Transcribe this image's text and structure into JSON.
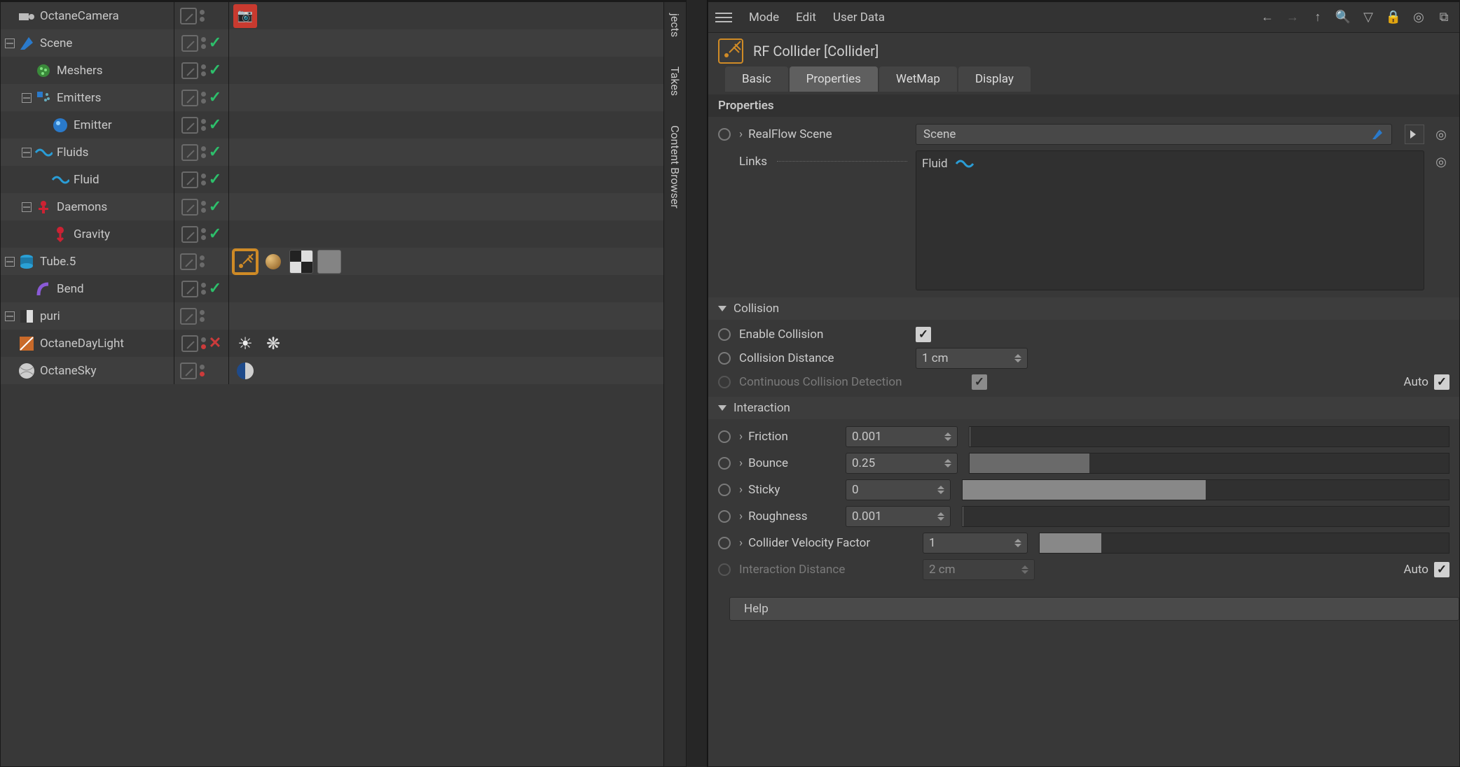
{
  "objects": {
    "items": [
      {
        "name": "OctaneCamera",
        "indent": 0,
        "expander": "none",
        "status": "none",
        "tags": [
          "camera-rec"
        ]
      },
      {
        "name": "Scene",
        "indent": 0,
        "expander": "minus",
        "status": "check",
        "tags": []
      },
      {
        "name": "Meshers",
        "indent": 1,
        "expander": "none",
        "status": "check",
        "tags": []
      },
      {
        "name": "Emitters",
        "indent": 1,
        "expander": "minus",
        "status": "check",
        "tags": []
      },
      {
        "name": "Emitter",
        "indent": 2,
        "expander": "none",
        "status": "check",
        "tags": []
      },
      {
        "name": "Fluids",
        "indent": 1,
        "expander": "minus",
        "status": "check",
        "tags": []
      },
      {
        "name": "Fluid",
        "indent": 2,
        "expander": "none",
        "status": "check",
        "tags": []
      },
      {
        "name": "Daemons",
        "indent": 1,
        "expander": "minus",
        "status": "check",
        "tags": []
      },
      {
        "name": "Gravity",
        "indent": 2,
        "expander": "none",
        "status": "check",
        "tags": []
      },
      {
        "name": "Tube.5",
        "indent": 0,
        "expander": "minus",
        "status": "none",
        "tags": [
          "collider",
          "ball",
          "checker",
          "noise"
        ],
        "selected_tag": 0
      },
      {
        "name": "Bend",
        "indent": 1,
        "expander": "none",
        "status": "check",
        "tags": []
      },
      {
        "name": "puri",
        "indent": 0,
        "expander": "plus",
        "status": "none",
        "tags": []
      },
      {
        "name": "OctaneDayLight",
        "indent": 0,
        "expander": "none",
        "status": "x",
        "dots": "red",
        "tags": [
          "sun",
          "gear"
        ]
      },
      {
        "name": "OctaneSky",
        "indent": 0,
        "expander": "none",
        "status": "none",
        "dots": "red",
        "tags": [
          "halfsphere"
        ]
      }
    ]
  },
  "side_tabs": {
    "objects_trunc": "jects",
    "takes": "Takes",
    "content_browser": "Content Browser"
  },
  "menu": {
    "mode": "Mode",
    "edit": "Edit",
    "user_data": "User Data"
  },
  "attr": {
    "title": "RF Collider [Collider]",
    "tabs": {
      "basic": "Basic",
      "properties": "Properties",
      "wetmap": "WetMap",
      "display": "Display"
    },
    "section": "Properties",
    "realflow_scene_label": "RealFlow Scene",
    "realflow_scene_value": "Scene",
    "links_label": "Links",
    "links_item": "Fluid",
    "groups": {
      "collision": "Collision",
      "interaction": "Interaction"
    },
    "collision": {
      "enable_label": "Enable Collision",
      "distance_label": "Collision Distance",
      "distance_value": "1 cm",
      "ccd_label": "Continuous Collision Detection",
      "auto_label": "Auto"
    },
    "interaction": {
      "friction_label": "Friction",
      "friction_value": "0.001",
      "friction_pct": 0.2,
      "bounce_label": "Bounce",
      "bounce_value": "0.25",
      "bounce_pct": 25,
      "sticky_label": "Sticky",
      "sticky_value": "0",
      "sticky_pct": 50,
      "roughness_label": "Roughness",
      "roughness_value": "0.001",
      "roughness_pct": 0.2,
      "cvf_label": "Collider Velocity Factor",
      "cvf_value": "1",
      "cvf_pct": 15,
      "idist_label": "Interaction Distance",
      "idist_value": "2 cm",
      "auto_label": "Auto"
    },
    "help": "Help"
  }
}
